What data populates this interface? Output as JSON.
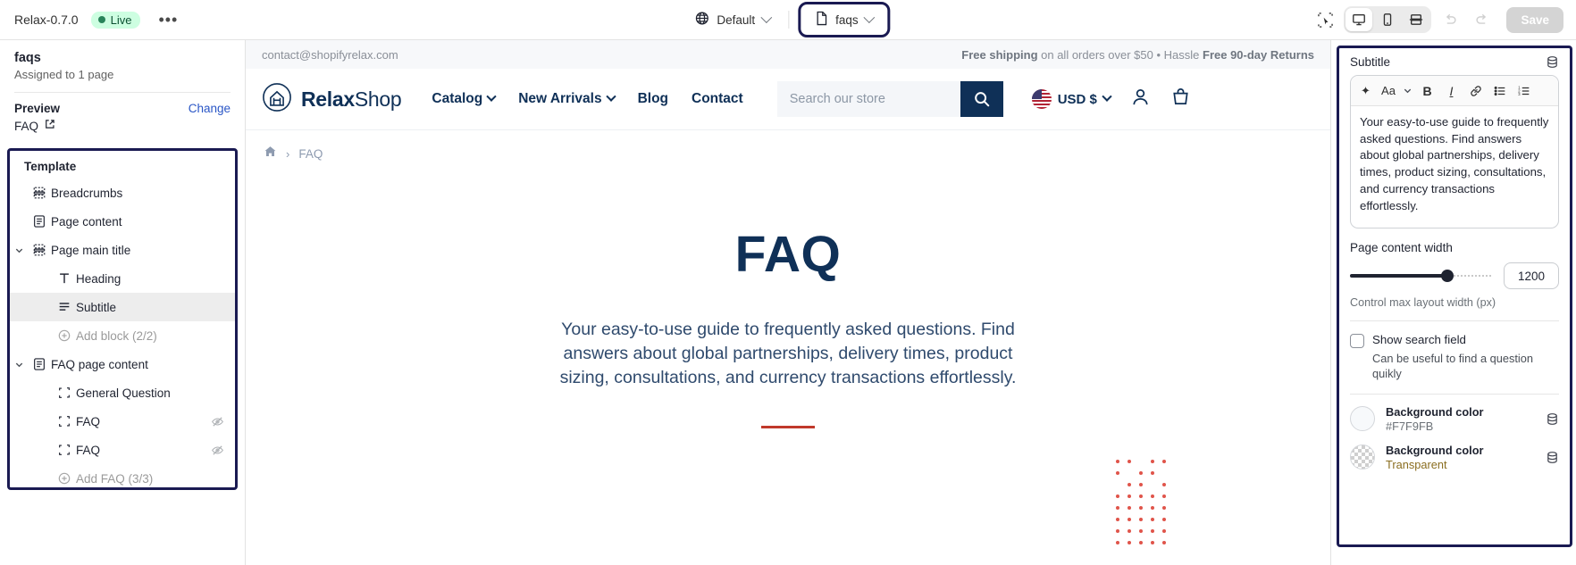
{
  "topbar": {
    "theme_name": "Relax-0.7.0",
    "status_badge": "Live",
    "more_label": "•••",
    "locale_label": "Default",
    "page_label": "faqs",
    "save_label": "Save",
    "icons": {
      "globe": "globe-icon",
      "page": "page-icon",
      "inspector": "inspector-cursor-icon",
      "desktop": "desktop-icon",
      "mobile": "mobile-icon",
      "fullwidth": "fullwidth-icon",
      "undo": "undo-icon",
      "redo": "redo-icon"
    }
  },
  "sidebar": {
    "template_name": "faqs",
    "assigned_text": "Assigned to 1 page",
    "preview_label": "Preview",
    "change_label": "Change",
    "preview_value": "FAQ",
    "template_heading": "Template",
    "tree": [
      {
        "label": "Breadcrumbs",
        "icon": "section-icon",
        "indent": 1,
        "caret": false,
        "state": "normal",
        "hidden_eye": false
      },
      {
        "label": "Page content",
        "icon": "content-icon",
        "indent": 1,
        "caret": false,
        "state": "normal",
        "hidden_eye": false
      },
      {
        "label": "Page main title",
        "icon": "section-icon",
        "indent": 1,
        "caret": true,
        "state": "normal",
        "hidden_eye": false
      },
      {
        "label": "Heading",
        "icon": "text-icon",
        "indent": 2,
        "caret": false,
        "state": "normal",
        "hidden_eye": false
      },
      {
        "label": "Subtitle",
        "icon": "subtitle-icon",
        "indent": 2,
        "caret": false,
        "state": "selected",
        "hidden_eye": false
      },
      {
        "label": "Add block (2/2)",
        "icon": "plus-icon",
        "indent": 2,
        "caret": false,
        "state": "muted",
        "hidden_eye": false
      },
      {
        "label": "FAQ page content",
        "icon": "content-icon",
        "indent": 1,
        "caret": true,
        "state": "normal",
        "hidden_eye": false
      },
      {
        "label": "General Question",
        "icon": "block-icon",
        "indent": 2,
        "caret": false,
        "state": "normal",
        "hidden_eye": false
      },
      {
        "label": "FAQ",
        "icon": "block-icon",
        "indent": 2,
        "caret": false,
        "state": "normal",
        "hidden_eye": true
      },
      {
        "label": "FAQ",
        "icon": "block-icon",
        "indent": 2,
        "caret": false,
        "state": "normal",
        "hidden_eye": true
      },
      {
        "label": "Add FAQ (3/3)",
        "icon": "plus-icon",
        "indent": 2,
        "caret": false,
        "state": "muted",
        "hidden_eye": false
      }
    ]
  },
  "preview": {
    "announcement": {
      "email": "contact@shopifyrelax.com",
      "promo_bold": "Free shipping",
      "promo_rest": " on all orders over $50 • Hassle ",
      "promo_bold2": "Free 90-day Returns"
    },
    "brand": {
      "bold": "Relax",
      "light": "Shop",
      "logo_icon": "house-logo-icon"
    },
    "nav": [
      {
        "label": "Catalog",
        "has_caret": true
      },
      {
        "label": "New Arrivals",
        "has_caret": true
      },
      {
        "label": "Blog",
        "has_caret": false
      },
      {
        "label": "Contact",
        "has_caret": false
      }
    ],
    "search_placeholder": "Search our store",
    "currency": "USD $",
    "breadcrumbs": [
      "FAQ"
    ],
    "hero_title": "FAQ",
    "hero_paragraph": "Your easy-to-use guide to frequently asked questions. Find answers about global partnerships, delivery times, product sizing, consultations, and currency transactions effortlessly."
  },
  "right_panel": {
    "section_title": "Subtitle",
    "rte_toolbar": [
      {
        "name": "ai-sparkle-icon",
        "glyph": "✦"
      },
      {
        "name": "font-size-icon",
        "glyph": "Aa"
      },
      {
        "name": "chevron-down-icon",
        "glyph": "⌄"
      },
      {
        "name": "bold-icon",
        "glyph": "B"
      },
      {
        "name": "italic-icon",
        "glyph": "I"
      },
      {
        "name": "link-icon",
        "glyph": "🔗"
      },
      {
        "name": "bullet-list-icon",
        "glyph": "≔"
      },
      {
        "name": "numbered-list-icon",
        "glyph": "≡"
      }
    ],
    "rte_value": "Your easy-to-use guide to frequently asked questions. Find answers about global partnerships, delivery times, product sizing, consultations, and currency transactions effortlessly.",
    "width_label": "Page content width",
    "width_value": "1200",
    "width_help": "Control max layout width (px)",
    "search_checkbox_label": "Show search field",
    "search_checkbox_help": "Can be useful to find a question quikly",
    "colors": [
      {
        "label": "Background color",
        "value": "#F7F9FB",
        "swatch": "#F7F9FB",
        "transparent": false
      },
      {
        "label": "Background color",
        "value": "Transparent",
        "swatch": "transparent",
        "transparent": true
      }
    ]
  }
}
